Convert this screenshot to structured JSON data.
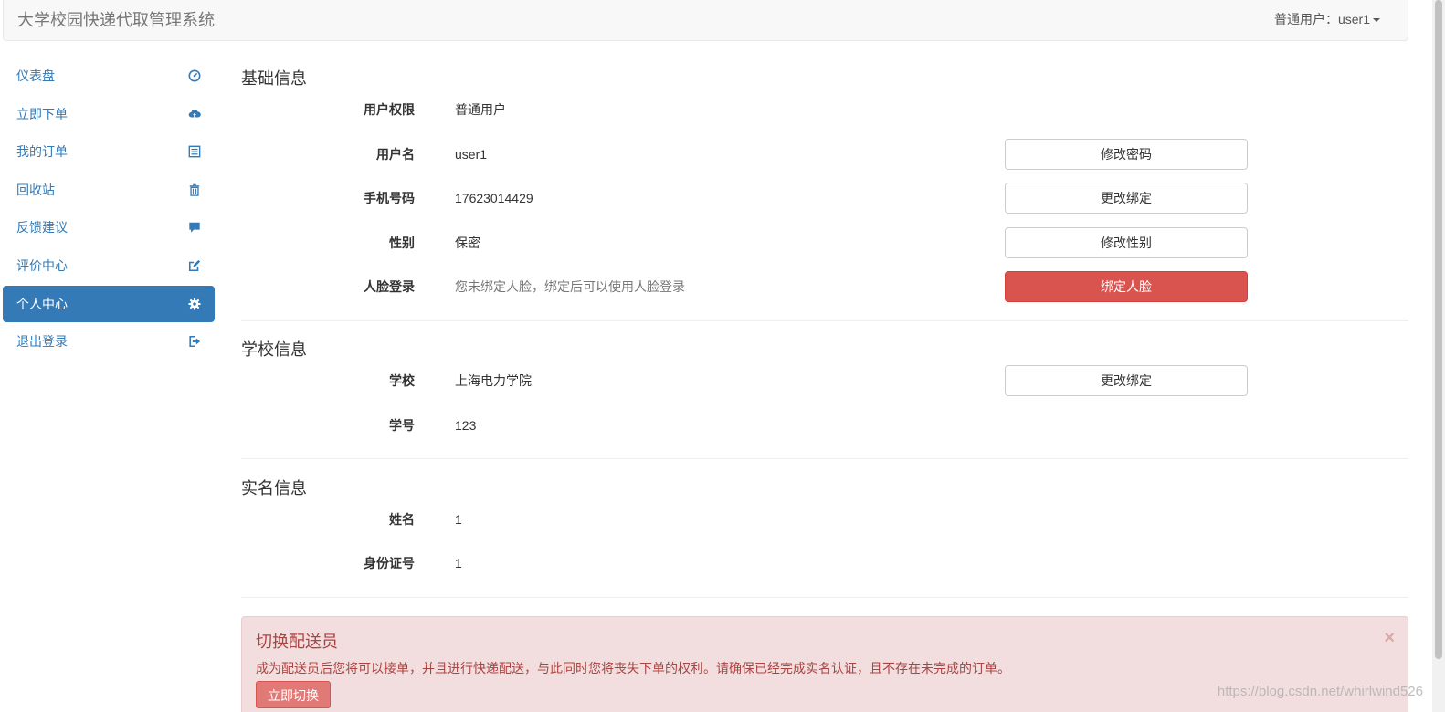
{
  "app": {
    "title": "大学校园快递代取管理系统"
  },
  "user_menu": {
    "label": "普通用户：user1"
  },
  "sidebar": {
    "items": [
      {
        "label": "仪表盘",
        "icon": "dashboard-icon"
      },
      {
        "label": "立即下单",
        "icon": "cloud-upload-icon"
      },
      {
        "label": "我的订单",
        "icon": "list-alt-icon"
      },
      {
        "label": "回收站",
        "icon": "trash-icon"
      },
      {
        "label": "反馈建议",
        "icon": "comment-icon"
      },
      {
        "label": "评价中心",
        "icon": "edit-icon"
      },
      {
        "label": "个人中心",
        "icon": "cog-icon",
        "active": true
      },
      {
        "label": "退出登录",
        "icon": "log-out-icon"
      }
    ]
  },
  "basic": {
    "title": "基础信息",
    "permission": {
      "label": "用户权限",
      "value": "普通用户"
    },
    "username": {
      "label": "用户名",
      "value": "user1",
      "button": "修改密码"
    },
    "phone": {
      "label": "手机号码",
      "value": "17623014429",
      "button": "更改绑定"
    },
    "gender": {
      "label": "性别",
      "value": "保密",
      "button": "修改性别"
    },
    "face": {
      "label": "人脸登录",
      "value": "您未绑定人脸，绑定后可以使用人脸登录",
      "button": "绑定人脸"
    }
  },
  "school": {
    "title": "学校信息",
    "school": {
      "label": "学校",
      "value": "上海电力学院",
      "button": "更改绑定"
    },
    "student_no": {
      "label": "学号",
      "value": "123"
    }
  },
  "realname": {
    "title": "实名信息",
    "name": {
      "label": "姓名",
      "value": "1"
    },
    "id_no": {
      "label": "身份证号",
      "value": "1"
    }
  },
  "alert": {
    "title": "切换配送员",
    "text": "成为配送员后您将可以接单，并且进行快递配送，与此同时您将丧失下单的权利。请确保已经完成实名认证，且不存在未完成的订单。",
    "button": "立即切换",
    "close": "×"
  },
  "watermark": "https://blog.csdn.net/whirlwind526",
  "colors": {
    "primary": "#337ab7",
    "danger": "#d9534f",
    "alert_bg": "#f2dede",
    "alert_text": "#a94442"
  }
}
